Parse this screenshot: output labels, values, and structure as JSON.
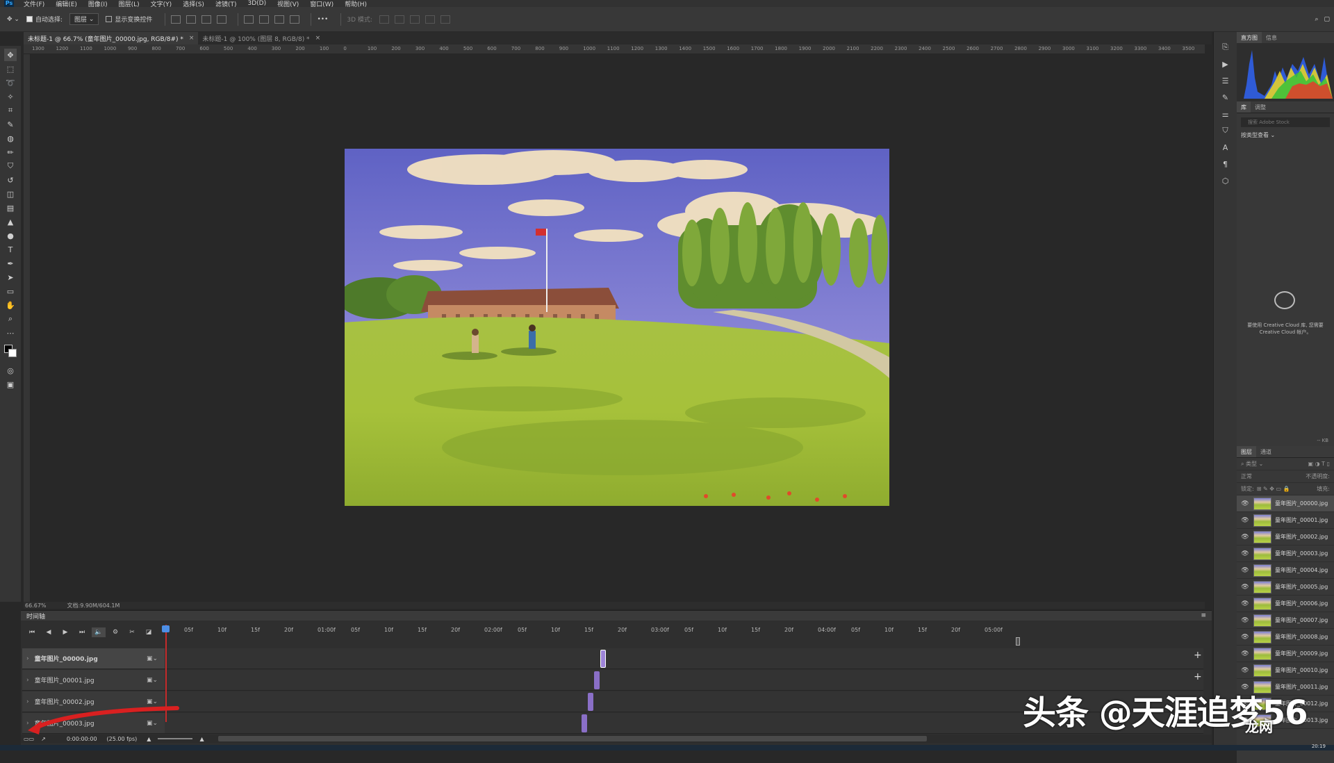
{
  "menu": {
    "items": [
      "文件(F)",
      "编辑(E)",
      "图像(I)",
      "图层(L)",
      "文字(Y)",
      "选择(S)",
      "滤镜(T)",
      "3D(D)",
      "视图(V)",
      "窗口(W)",
      "帮助(H)"
    ]
  },
  "options": {
    "auto_select_label": "自动选择:",
    "auto_select_target": "图层",
    "show_transform_label": "显示变换控件",
    "mode_3d_label": "3D 模式:",
    "more": "•••"
  },
  "tabs": [
    {
      "label": "未标题-1 @ 66.7% (童年图片_00000.jpg, RGB/8#) *",
      "active": true
    },
    {
      "label": "未标题-1 @ 100% (图层 8, RGB/8) *",
      "active": false
    }
  ],
  "ruler_top_labels": [
    "1300",
    "1200",
    "1100",
    "1000",
    "900",
    "800",
    "700",
    "600",
    "500",
    "400",
    "300",
    "200",
    "100",
    "0",
    "100",
    "200",
    "300",
    "400",
    "500",
    "600",
    "700",
    "800",
    "900",
    "1000",
    "1100",
    "1200",
    "1300",
    "1400",
    "1500",
    "1600",
    "1700",
    "1800",
    "1900",
    "2000",
    "2100",
    "2200",
    "2300",
    "2400",
    "2500",
    "2600",
    "2700",
    "2800",
    "2900",
    "3000",
    "3100",
    "3200",
    "3300",
    "3400",
    "3500"
  ],
  "status": {
    "zoom": "66.67%",
    "doc_size": "文档:9.90M/604.1M"
  },
  "timeline": {
    "title": "时间轴",
    "ruler_ticks": [
      "05f",
      "10f",
      "15f",
      "20f",
      "01:00f",
      "05f",
      "10f",
      "15f",
      "20f",
      "02:00f",
      "05f",
      "10f",
      "15f",
      "20f",
      "03:00f",
      "05f",
      "10f",
      "15f",
      "20f",
      "04:00f",
      "05f",
      "10f",
      "15f",
      "20f",
      "05:00f"
    ],
    "tracks": [
      {
        "name": "童年图片_00000.jpg",
        "selected": true
      },
      {
        "name": "童年图片_00001.jpg",
        "selected": false
      },
      {
        "name": "童年图片_00002.jpg",
        "selected": false
      },
      {
        "name": "童年图片_00003.jpg",
        "selected": false
      }
    ],
    "timecode": "0:00:00:00",
    "fps": "(25.00 fps)"
  },
  "panels": {
    "histogram_tabs": [
      "直方图",
      "信息"
    ],
    "library_tabs": [
      "库",
      "调整"
    ],
    "library_search_placeholder": "搜索 Adobe Stock",
    "library_filter": "按类型查看",
    "cc_message": "要使用 Creative Cloud 库, 您需要 Creative Cloud 帐户。",
    "library_size": "-- KB",
    "layers_tabs": [
      "图层",
      "通道"
    ],
    "layers_filter": "类型",
    "blend_mode": "正常",
    "opacity_label": "不透明度:",
    "lock_label": "锁定:",
    "fill_label": "填充:",
    "layers": [
      "童年图片_00000.jpg",
      "童年图片_00001.jpg",
      "童年图片_00002.jpg",
      "童年图片_00003.jpg",
      "童年图片_00004.jpg",
      "童年图片_00005.jpg",
      "童年图片_00006.jpg",
      "童年图片_00007.jpg",
      "童年图片_00008.jpg",
      "童年图片_00009.jpg",
      "童年图片_00010.jpg",
      "童年图片_00011.jpg",
      "童年图片_00012.jpg",
      "童年图片_00013.jpg"
    ]
  },
  "taskbar": {
    "clock": "20:19"
  },
  "watermark": {
    "text": "头条 @天涯追梦56",
    "sub": "龙网"
  },
  "colors": {
    "accent": "#31a8ff",
    "clip": "#8a6fc7",
    "playhead": "#c62b2b",
    "annotation": "#d92020"
  }
}
